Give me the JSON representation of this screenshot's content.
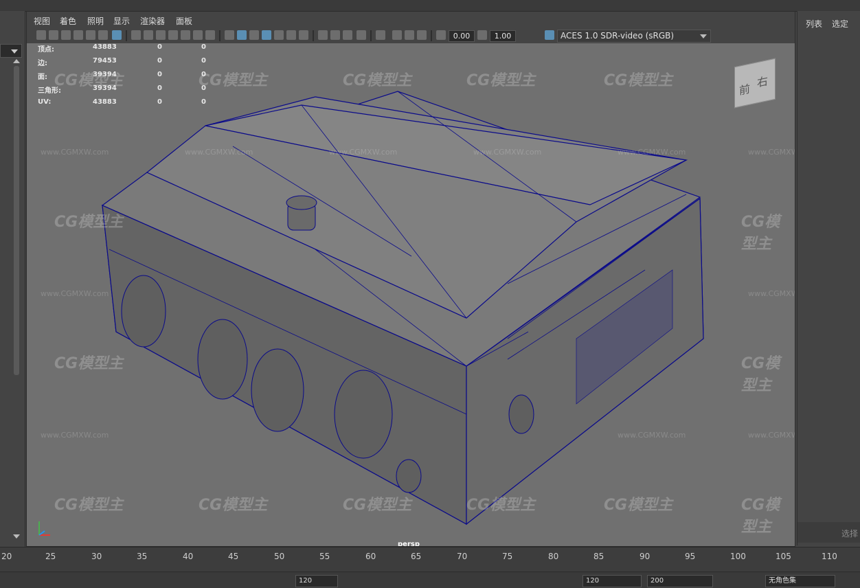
{
  "menubar": {
    "items": [
      "视图",
      "着色",
      "照明",
      "显示",
      "渲染器",
      "面板"
    ]
  },
  "toolbar": {
    "exposure_value": "0.00",
    "gamma_value": "1.00",
    "color_space": "ACES 1.0 SDR-video (sRGB)"
  },
  "hud": {
    "rows": [
      {
        "label": "顶点:",
        "v1": "43883",
        "v2": "0",
        "v3": "0"
      },
      {
        "label": "边:",
        "v1": "79453",
        "v2": "0",
        "v3": "0"
      },
      {
        "label": "面:",
        "v1": "39394",
        "v2": "0",
        "v3": "0"
      },
      {
        "label": "三角形:",
        "v1": "39394",
        "v2": "0",
        "v3": "0"
      },
      {
        "label": "UV:",
        "v1": "43883",
        "v2": "0",
        "v3": "0"
      }
    ],
    "camera_name": "persp"
  },
  "viewcube": {
    "front": "前",
    "right": "右"
  },
  "watermark": {
    "logo": "CG模型主",
    "url": "www.CGMXW.com"
  },
  "right_panel": {
    "tab_list": "列表",
    "tab_select": "选定",
    "select_label": "选择"
  },
  "timeline": {
    "ticks": [
      "20",
      "25",
      "30",
      "35",
      "40",
      "45",
      "50",
      "55",
      "60",
      "65",
      "70",
      "75",
      "80",
      "85",
      "90",
      "95",
      "100",
      "105",
      "110"
    ]
  },
  "bottom": {
    "field1": "120",
    "field2": "120",
    "field3": "200",
    "char_set": "无角色集"
  },
  "colors": {
    "wireframe": "#0a0a8a",
    "viewport_bg": "#707070",
    "accent": "#5a8fb4"
  }
}
